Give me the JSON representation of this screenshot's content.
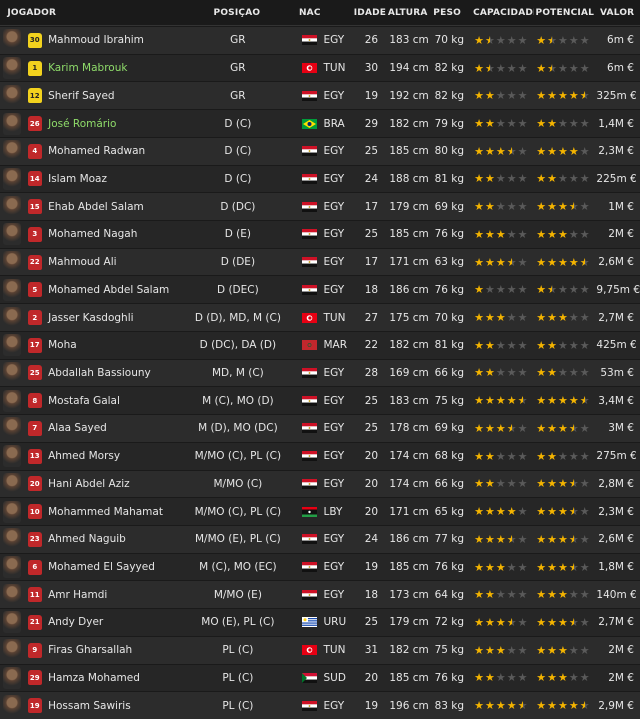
{
  "headers": {
    "player": "JOGADOR",
    "position": "POSIÇÃO",
    "nat": "NAC",
    "age": "IDADE",
    "height": "ALTURA",
    "weight": "PESO",
    "ability": "CAPACIDADE",
    "potential": "POTENCIAL",
    "value": "VALOR"
  },
  "players": [
    {
      "shirt": "30",
      "gk": true,
      "name": "Mahmoud Ibrahim",
      "pos": "GR",
      "flag": "egy",
      "nat": "EGY",
      "age": "26",
      "height": "183 cm",
      "weight": "70 kg",
      "ca": 1.5,
      "pa": 1.5,
      "value": "6m €"
    },
    {
      "shirt": "1",
      "gk": true,
      "name": "Karim Mabrouk",
      "green": true,
      "pos": "GR",
      "flag": "tun",
      "nat": "TUN",
      "age": "30",
      "height": "194 cm",
      "weight": "82 kg",
      "ca": 1.5,
      "pa": 1.5,
      "value": "6m €"
    },
    {
      "shirt": "12",
      "gk": true,
      "name": "Sherif Sayed",
      "pos": "GR",
      "flag": "egy",
      "nat": "EGY",
      "age": "19",
      "height": "192 cm",
      "weight": "82 kg",
      "ca": 2,
      "pa": 4.5,
      "value": "325m €"
    },
    {
      "shirt": "26",
      "name": "José Romário",
      "green": true,
      "pos": "D (C)",
      "flag": "bra",
      "nat": "BRA",
      "age": "29",
      "height": "182 cm",
      "weight": "79 kg",
      "ca": 2,
      "pa": 2,
      "value": "1,4M €"
    },
    {
      "shirt": "4",
      "name": "Mohamed Radwan",
      "pos": "D (C)",
      "flag": "egy",
      "nat": "EGY",
      "age": "25",
      "height": "185 cm",
      "weight": "80 kg",
      "ca": 3.5,
      "pa": 4,
      "value": "2,3M €"
    },
    {
      "shirt": "14",
      "name": "Islam Moaz",
      "pos": "D (C)",
      "flag": "egy",
      "nat": "EGY",
      "age": "24",
      "height": "188 cm",
      "weight": "81 kg",
      "ca": 2,
      "pa": 2,
      "value": "225m €"
    },
    {
      "shirt": "15",
      "name": "Ehab Abdel Salam",
      "pos": "D (DC)",
      "flag": "egy",
      "nat": "EGY",
      "age": "17",
      "height": "179 cm",
      "weight": "69 kg",
      "ca": 2,
      "pa": 3.5,
      "value": "1M €"
    },
    {
      "shirt": "3",
      "name": "Mohamed Nagah",
      "pos": "D (E)",
      "flag": "egy",
      "nat": "EGY",
      "age": "25",
      "height": "185 cm",
      "weight": "76 kg",
      "ca": 3,
      "pa": 3,
      "value": "2M €"
    },
    {
      "shirt": "22",
      "name": "Mahmoud Ali",
      "pos": "D (DE)",
      "flag": "egy",
      "nat": "EGY",
      "age": "17",
      "height": "171 cm",
      "weight": "63 kg",
      "ca": 3.5,
      "pa": 4.5,
      "value": "2,6M €"
    },
    {
      "shirt": "5",
      "name": "Mohamed Abdel Salam",
      "pos": "D (DEC)",
      "flag": "egy",
      "nat": "EGY",
      "age": "18",
      "height": "186 cm",
      "weight": "76 kg",
      "ca": 1,
      "pa": 1.5,
      "value": "9,75m €"
    },
    {
      "shirt": "2",
      "name": "Jasser Kasdoghli",
      "pos": "D (D), MD, M (C)",
      "flag": "tun",
      "nat": "TUN",
      "age": "27",
      "height": "175 cm",
      "weight": "70 kg",
      "ca": 3,
      "pa": 3,
      "value": "2,7M €"
    },
    {
      "shirt": "17",
      "name": "Moha",
      "pos": "D (DC), DA (D)",
      "flag": "mar",
      "nat": "MAR",
      "age": "22",
      "height": "182 cm",
      "weight": "81 kg",
      "ca": 2,
      "pa": 2,
      "value": "425m €"
    },
    {
      "shirt": "25",
      "name": "Abdallah Bassiouny",
      "pos": "MD, M (C)",
      "flag": "egy",
      "nat": "EGY",
      "age": "28",
      "height": "169 cm",
      "weight": "66 kg",
      "ca": 2,
      "pa": 2,
      "value": "53m €"
    },
    {
      "shirt": "8",
      "name": "Mostafa Galal",
      "pos": "M (C), MO (D)",
      "flag": "egy",
      "nat": "EGY",
      "age": "25",
      "height": "183 cm",
      "weight": "75 kg",
      "ca": 4.5,
      "pa": 4.5,
      "value": "3,4M €"
    },
    {
      "shirt": "7",
      "name": "Alaa Sayed",
      "pos": "M (D), MO (DC)",
      "flag": "egy",
      "nat": "EGY",
      "age": "25",
      "height": "178 cm",
      "weight": "69 kg",
      "ca": 3.5,
      "pa": 3.5,
      "value": "3M €"
    },
    {
      "shirt": "13",
      "name": "Ahmed Morsy",
      "pos": "M/MO (C), PL (C)",
      "flag": "egy",
      "nat": "EGY",
      "age": "20",
      "height": "174 cm",
      "weight": "68 kg",
      "ca": 2,
      "pa": 2,
      "value": "275m €"
    },
    {
      "shirt": "20",
      "name": "Hani Abdel Aziz",
      "pos": "M/MO (C)",
      "flag": "egy",
      "nat": "EGY",
      "age": "20",
      "height": "174 cm",
      "weight": "66 kg",
      "ca": 2,
      "pa": 3.5,
      "value": "2,8M €"
    },
    {
      "shirt": "10",
      "name": "Mohammed Mahamat",
      "pos": "M/MO (C), PL (C)",
      "flag": "lby",
      "nat": "LBY",
      "age": "20",
      "height": "171 cm",
      "weight": "65 kg",
      "ca": 4,
      "pa": 3.5,
      "value": "2,3M €"
    },
    {
      "shirt": "23",
      "name": "Ahmed Naguib",
      "pos": "M/MO (E), PL (C)",
      "flag": "egy",
      "nat": "EGY",
      "age": "24",
      "height": "186 cm",
      "weight": "77 kg",
      "ca": 3.5,
      "pa": 3.5,
      "value": "2,6M €"
    },
    {
      "shirt": "6",
      "name": "Mohamed El Sayyed",
      "pos": "M (C), MO (EC)",
      "flag": "egy",
      "nat": "EGY",
      "age": "19",
      "height": "185 cm",
      "weight": "76 kg",
      "ca": 3,
      "pa": 3.5,
      "value": "1,8M €"
    },
    {
      "shirt": "11",
      "name": "Amr Hamdi",
      "pos": "M/MO (E)",
      "flag": "egy",
      "nat": "EGY",
      "age": "18",
      "height": "173 cm",
      "weight": "64 kg",
      "ca": 2,
      "pa": 3,
      "value": "140m €"
    },
    {
      "shirt": "21",
      "name": "Andy Dyer",
      "pos": "MO (E), PL (C)",
      "flag": "uru",
      "nat": "URU",
      "age": "25",
      "height": "179 cm",
      "weight": "72 kg",
      "ca": 3.5,
      "pa": 3.5,
      "value": "2,7M €"
    },
    {
      "shirt": "9",
      "name": "Firas Gharsallah",
      "pos": "PL (C)",
      "flag": "tun",
      "nat": "TUN",
      "age": "31",
      "height": "182 cm",
      "weight": "75 kg",
      "ca": 3,
      "pa": 3,
      "value": "2M €"
    },
    {
      "shirt": "29",
      "name": "Hamza Mohamed",
      "pos": "PL (C)",
      "flag": "sud",
      "nat": "SUD",
      "age": "20",
      "height": "185 cm",
      "weight": "76 kg",
      "ca": 2,
      "pa": 3,
      "value": "2M €"
    },
    {
      "shirt": "19",
      "name": "Hossam Sawiris",
      "pos": "PL (C)",
      "flag": "egy",
      "nat": "EGY",
      "age": "19",
      "height": "196 cm",
      "weight": "83 kg",
      "ca": 4.5,
      "pa": 4.5,
      "value": "2,9M €"
    }
  ]
}
